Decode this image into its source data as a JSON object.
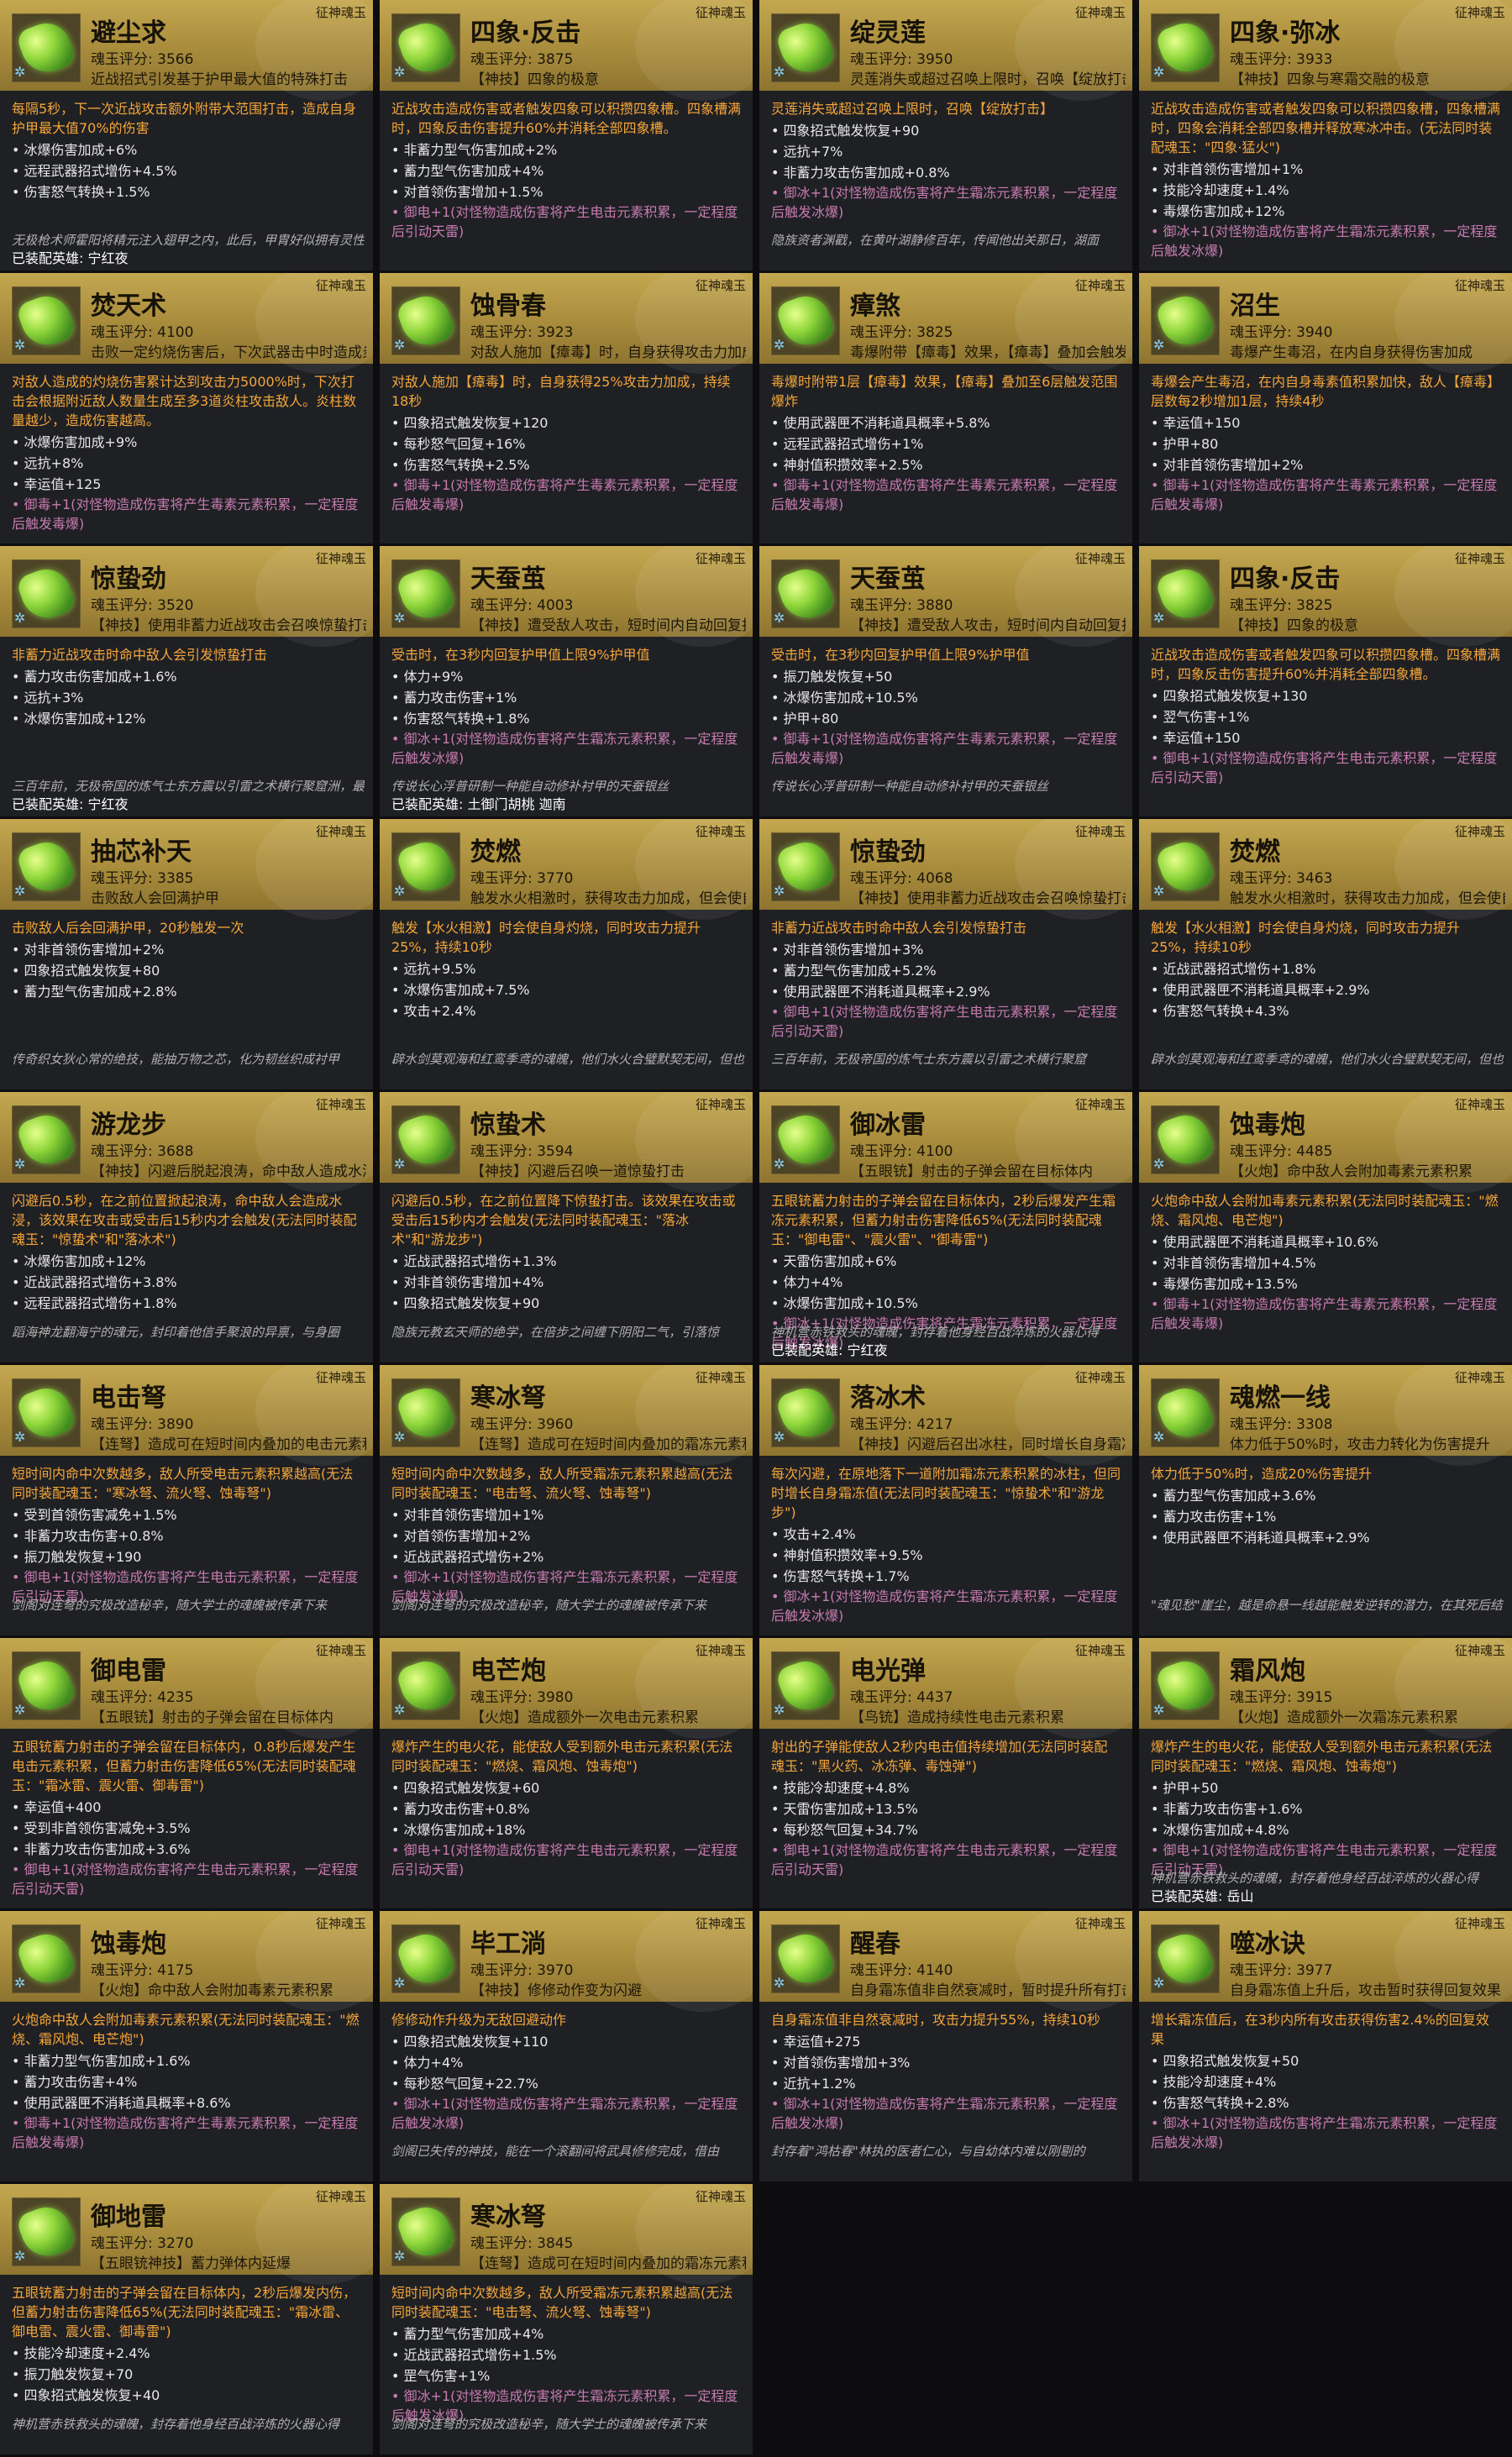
{
  "cards": [
    {
      "name": "避尘求",
      "tag": "征神魂玉",
      "score": "魂玉评分: 3566",
      "desc": "近战招式引发基于护甲最大值的特殊打击",
      "effect": "每隔5秒，下一次近战攻击额外附带大范围打击，造成自身护甲最大值70%的伤害",
      "stats": [
        "冰爆伤害加成+6%",
        "远程武器招式增伤+4.5%",
        "伤害怒气转换+1.5%"
      ],
      "eff2": "",
      "lore": "无极枪术师霍阳将精元注入翅甲之内，此后，甲胄好似拥有灵性般助他脱战躲胜",
      "equipped": "已装配英雄: 宁红夜"
    },
    {
      "name": "四象·反击",
      "tag": "征神魂玉",
      "score": "魂玉评分: 3875",
      "desc": "【神技】四象的极意",
      "effect": "近战攻击造成伤害或者触发四象可以积攒四象槽。四象槽满时，四象反击伤害提升60%并消耗全部四象槽。",
      "stats": [
        "非蓄力型气伤害加成+2%",
        "蓄力型气伤害加成+4%",
        "对首领伤害增加+1.5%"
      ],
      "eff2": "御电+1(对怪物造成伤害将产生电击元素积累，一定程度后引动天雷)",
      "lore": "",
      "equipped": ""
    },
    {
      "name": "绽灵莲",
      "tag": "征神魂玉",
      "score": "魂玉评分: 3950",
      "desc": "灵莲消失或超过召唤上限时，召唤【绽放打击】",
      "effect": "灵莲消失或超过召唤上限时，召唤【绽放打击】",
      "stats": [
        "四象招式触发恢复+90",
        "远抗+7%",
        "非蓄力攻击伤害加成+0.8%"
      ],
      "eff2": "御冰+1(对怪物造成伤害将产生霜冻元素积累，一定程度后触发冰爆)",
      "lore": "隐族资者渊戳，在黄叶湖静修百年，传闻他出关那日，湖面",
      "equipped": ""
    },
    {
      "name": "四象·弥冰",
      "tag": "征神魂玉",
      "score": "魂玉评分: 3933",
      "desc": "【神技】四象与寒霜交融的极意",
      "effect": "近战攻击造成伤害或者触发四象可以积攒四象槽，四象槽满时，四象会消耗全部四象槽并释放寒冰冲击。(无法同时装配魂玉：\"四象·猛火\")",
      "stats": [
        "对非首领伤害增加+1%",
        "技能冷却速度+1.4%",
        "毒爆伤害加成+12%"
      ],
      "eff2": "御冰+1(对怪物造成伤害将产生霜冻元素积累，一定程度后触发冰爆)",
      "lore": "",
      "equipped": ""
    },
    {
      "name": "焚天术",
      "tag": "征神魂玉",
      "score": "魂玉评分: 4100",
      "desc": "击败一定约烧伤害后，下次武器击中时造成炎柱",
      "effect": "对敌人造成的灼烧伤害累计达到攻击力5000%时，下次打击会根据附近敌人数量生成至多3道炎柱攻击敌人。炎柱数量越少，造成伤害越高。",
      "stats": [
        "冰爆伤害加成+9%",
        "远抗+8%",
        "幸运值+125"
      ],
      "eff2": "御毒+1(对怪物造成伤害将产生毒素元素积累，一定程度后触发毒爆)",
      "lore": "",
      "equipped": ""
    },
    {
      "name": "蚀骨春",
      "tag": "征神魂玉",
      "score": "魂玉评分: 3923",
      "desc": "对敌人施加【瘴毒】时，自身获得攻击力加成",
      "effect": "对敌人施加【瘴毒】时，自身获得25%攻击力加成，持续18秒",
      "stats": [
        "四象招式触发恢复+120",
        "每秒怒气回复+16%",
        "伤害怒气转换+2.5%"
      ],
      "eff2": "御毒+1(对怪物造成伤害将产生毒素元素积累，一定程度后触发毒爆)",
      "lore": "",
      "equipped": ""
    },
    {
      "name": "瘴煞",
      "tag": "征神魂玉",
      "score": "魂玉评分: 3825",
      "desc": "毒爆附带【瘴毒】效果，【瘴毒】叠加会触发范围打击",
      "effect": "毒爆时附带1层【瘴毒】效果，【瘴毒】叠加至6层触发范围爆炸",
      "stats": [
        "使用武器匣不消耗道具概率+5.8%",
        "远程武器招式增伤+1%",
        "神射值积攒效率+2.5%"
      ],
      "eff2": "御毒+1(对怪物造成伤害将产生毒素元素积累，一定程度后触发毒爆)",
      "lore": "",
      "equipped": ""
    },
    {
      "name": "沼生",
      "tag": "征神魂玉",
      "score": "魂玉评分: 3940",
      "desc": "毒爆产生毒沼，在内自身获得伤害加成",
      "effect": "毒爆会产生毒沼，在内自身毒素值积累加快，敌人【瘴毒】层数每2秒增加1层，持续4秒",
      "stats": [
        "幸运值+150",
        "护甲+80",
        "对非首领伤害增加+2%"
      ],
      "eff2": "御毒+1(对怪物造成伤害将产生毒素元素积累，一定程度后触发毒爆)",
      "lore": "",
      "equipped": ""
    },
    {
      "name": "惊蛰劲",
      "tag": "征神魂玉",
      "score": "魂玉评分: 3520",
      "desc": "【神技】使用非蓄力近战攻击会召唤惊蛰打击",
      "effect": "非蓄力近战攻击时命中敌人会引发惊蛰打击",
      "stats": [
        "蓄力攻击伤害加成+1.6%",
        "远抗+3%",
        "冰爆伤害加成+12%"
      ],
      "eff2": "",
      "lore": "三百年前，无极帝国的炼气士东方震以引雷之术横行聚窟洲，最后他散于苍穹之手",
      "equipped": "已装配英雄: 宁红夜"
    },
    {
      "name": "天蚕茧",
      "tag": "征神魂玉",
      "score": "魂玉评分: 4003",
      "desc": "【神技】遭受敌人攻击，短时间内自动回复护甲值",
      "effect": "受击时，在3秒内回复护甲值上限9%护甲值",
      "stats": [
        "体力+9%",
        "蓄力攻击伤害+1%",
        "伤害怒气转换+1.8%"
      ],
      "eff2": "御冰+1(对怪物造成伤害将产生霜冻元素积累，一定程度后触发冰爆)",
      "lore": "传说长心浮普研制一种能自动修补衬甲的天蚕银丝",
      "equipped": "已装配英雄: 土御门胡桃 迦南"
    },
    {
      "name": "天蚕茧",
      "tag": "征神魂玉",
      "score": "魂玉评分: 3880",
      "desc": "【神技】遭受敌人攻击，短时间内自动回复护甲值",
      "effect": "受击时，在3秒内回复护甲值上限9%护甲值",
      "stats": [
        "振刀触发恢复+50",
        "冰爆伤害加成+10.5%",
        "护甲+80"
      ],
      "eff2": "御毒+1(对怪物造成伤害将产生毒素元素积累，一定程度后触发毒爆)",
      "lore": "传说长心浮普研制一种能自动修补衬甲的天蚕银丝",
      "equipped": ""
    },
    {
      "name": "四象·反击",
      "tag": "征神魂玉",
      "score": "魂玉评分: 3825",
      "desc": "【神技】四象的极意",
      "effect": "近战攻击造成伤害或者触发四象可以积攒四象槽。四象槽满时，四象反击伤害提升60%并消耗全部四象槽。",
      "stats": [
        "四象招式触发恢复+130",
        "翌气伤害+1%",
        "幸运值+150"
      ],
      "eff2": "御电+1(对怪物造成伤害将产生电击元素积累，一定程度后引动天雷)",
      "lore": "",
      "equipped": ""
    },
    {
      "name": "抽芯补天",
      "tag": "征神魂玉",
      "score": "魂玉评分: 3385",
      "desc": "击败敌人会回满护甲",
      "effect": "击败敌人后会回满护甲，20秒触发一次",
      "stats": [
        "对非首领伤害增加+2%",
        "四象招式触发恢复+80",
        "蓄力型气伤害加成+2.8%"
      ],
      "eff2": "",
      "lore": "传奇织女狄心常的绝技，能抽万物之芯，化为韧丝织成衬甲",
      "equipped": ""
    },
    {
      "name": "焚燃",
      "tag": "征神魂玉",
      "score": "魂玉评分: 3770",
      "desc": "触发水火相激时，获得攻击力加成，但会使自身灼烧",
      "effect": "触发【水火相激】时会使自身灼烧，同时攻击力提升25%，持续10秒",
      "stats": [
        "远抗+9.5%",
        "冰爆伤害加成+7.5%",
        "攻击+2.4%"
      ],
      "eff2": "",
      "lore": "辟水剑莫观海和红鸾季鸢的魂魄，他们水火合璧默契无间，但也为彼此所伤",
      "equipped": ""
    },
    {
      "name": "惊蛰劲",
      "tag": "征神魂玉",
      "score": "魂玉评分: 4068",
      "desc": "【神技】使用非蓄力近战攻击会召唤惊蛰打击",
      "effect": "非蓄力近战攻击时命中敌人会引发惊蛰打击",
      "stats": [
        "对非首领伤害增加+3%",
        "蓄力型气伤害加成+5.2%",
        "使用武器匣不消耗道具概率+2.9%"
      ],
      "eff2": "御电+1(对怪物造成伤害将产生电击元素积累，一定程度后引动天雷)",
      "lore": "三百年前，无极帝国的炼气士东方震以引雷之术横行聚窟",
      "equipped": ""
    },
    {
      "name": "焚燃",
      "tag": "征神魂玉",
      "score": "魂玉评分: 3463",
      "desc": "触发水火相激时，获得攻击力加成，但会使自身灼烧",
      "effect": "触发【水火相激】时会使自身灼烧，同时攻击力提升25%，持续10秒",
      "stats": [
        "近战武器招式增伤+1.8%",
        "使用武器匣不消耗道具概率+2.9%",
        "伤害怒气转换+4.3%"
      ],
      "eff2": "",
      "lore": "辟水剑莫观海和红鸾季鸢的魂魄，他们水火合璧默契无间，但也为彼此所伤",
      "equipped": ""
    },
    {
      "name": "游龙步",
      "tag": "征神魂玉",
      "score": "魂玉评分: 3688",
      "desc": "【神技】闪避后脱起浪涛，命中敌人造成水浸",
      "effect": "闪避后0.5秒，在之前位置掀起浪涛，命中敌人会造成水浸，该效果在攻击或受击后15秒内才会触发(无法同时装配魂玉：\"惊蛰术\"和\"落冰术\")",
      "stats": [
        "冰爆伤害加成+12%",
        "近战武器招式增伤+3.8%",
        "远程武器招式增伤+1.8%"
      ],
      "eff2": "",
      "lore": "蹈海神龙翻海宁的魂元，封印着他信手聚浪的异禀，与身圈",
      "equipped": ""
    },
    {
      "name": "惊蛰术",
      "tag": "征神魂玉",
      "score": "魂玉评分: 3594",
      "desc": "【神技】闪避后召唤一道惊蛰打击",
      "effect": "闪避后0.5秒，在之前位置降下惊蛰打击。该效果在攻击或受击后15秒内才会触发(无法同时装配魂玉：\"落冰术\"和\"游龙步\")",
      "stats": [
        "近战武器招式增伤+1.3%",
        "对非首领伤害增加+4%",
        "四象招式触发恢复+90"
      ],
      "eff2": "",
      "lore": "隐族元教玄天师的绝学，在倍步之间缠下阴阳二气，引落惊",
      "equipped": ""
    },
    {
      "name": "御冰雷",
      "tag": "征神魂玉",
      "score": "魂玉评分: 4100",
      "desc": "【五眼铳】射击的子弹会留在目标体内",
      "effect": "五眼铳蓄力射击的子弹会留在目标体内，2秒后爆发产生霜冻元素积累，但蓄力射击伤害降低65%(无法同时装配魂玉：\"御电雷\"、\"震火雷\"、\"御毒雷\")",
      "stats": [
        "天雷伤害加成+6%",
        "体力+4%",
        "冰爆伤害加成+10.5%"
      ],
      "eff2": "御冰+1(对怪物造成伤害将产生霜冻元素积累，一定程度后触发冰爆)",
      "lore": "神机营赤铁救头的魂魄，封存着他身经百战淬炼的火器心得",
      "equipped": "已装配英雄: 宁红夜"
    },
    {
      "name": "蚀毒炮",
      "tag": "征神魂玉",
      "score": "魂玉评分: 4485",
      "desc": "【火炮】命中敌人会附加毒素元素积累",
      "effect": "火炮命中敌人会附加毒素元素积累(无法同时装配魂玉：\"燃烧、霜风炮、电芒炮\")",
      "stats": [
        "使用武器匣不消耗道具概率+10.6%",
        "对非首领伤害增加+4.5%",
        "毒爆伤害加成+13.5%"
      ],
      "eff2": "御毒+1(对怪物造成伤害将产生毒素元素积累，一定程度后触发毒爆)",
      "lore": "",
      "equipped": ""
    },
    {
      "name": "电击弩",
      "tag": "征神魂玉",
      "score": "魂玉评分: 3890",
      "desc": "【连弩】造成可在短时间内叠加的电击元素积累",
      "effect": "短时间内命中次数越多，敌人所受电击元素积累越高(无法同时装配魂玉：\"寒冰弩、流火弩、蚀毒弩\")",
      "stats": [
        "受到首领伤害减免+1.5%",
        "非蓄力攻击伤害+0.8%",
        "振刀触发恢复+190"
      ],
      "eff2": "御电+1(对怪物造成伤害将产生电击元素积累，一定程度后引动天雷)",
      "lore": "剑阁对连弩的究极改造秘辛，随大学士的魂魄被传承下来",
      "equipped": ""
    },
    {
      "name": "寒冰弩",
      "tag": "征神魂玉",
      "score": "魂玉评分: 3960",
      "desc": "【连弩】造成可在短时间内叠加的霜冻元素积累",
      "effect": "短时间内命中次数越多，敌人所受霜冻元素积累越高(无法同时装配魂玉：\"电击弩、流火弩、蚀毒弩\")",
      "stats": [
        "对非首领伤害增加+1%",
        "对首领伤害增加+2%",
        "近战武器招式增伤+2%"
      ],
      "eff2": "御冰+1(对怪物造成伤害将产生霜冻元素积累，一定程度后触发冰爆)",
      "lore": "剑阁对连弩的究极改造秘辛，随大学士的魂魄被传承下来",
      "equipped": ""
    },
    {
      "name": "落冰术",
      "tag": "征神魂玉",
      "score": "魂玉评分: 4217",
      "desc": "【神技】闪避后召出冰柱，同时增长自身霜冻值",
      "effect": "每次闪避，在原地落下一道附加霜冻元素积累的冰柱，但同时增长自身霜冻值(无法同时装配魂玉：\"惊蛰术\"和\"游龙步\")",
      "stats": [
        "攻击+2.4%",
        "神射值积攒效率+9.5%",
        "伤害怒气转换+1.7%"
      ],
      "eff2": "御冰+1(对怪物造成伤害将产生霜冻元素积累，一定程度后触发冰爆)",
      "lore": "",
      "equipped": ""
    },
    {
      "name": "魂燃一线",
      "tag": "征神魂玉",
      "score": "魂玉评分: 3308",
      "desc": "体力低于50%时，攻击力转化为伤害提升",
      "effect": "体力低于50%时，造成20%伤害提升",
      "stats": [
        "蓄力型气伤害加成+3.6%",
        "蓄力攻击伤害+1%",
        "使用武器匣不消耗道具概率+2.9%"
      ],
      "eff2": "",
      "lore": "\"魂见愁\"崖尘，越是命悬一线越能触发逆转的潜力，在其死后结晶于此",
      "equipped": ""
    },
    {
      "name": "御电雷",
      "tag": "征神魂玉",
      "score": "魂玉评分: 4235",
      "desc": "【五眼铳】射击的子弹会留在目标体内",
      "effect": "五眼铳蓄力射击的子弹会留在目标体内，0.8秒后爆发产生电击元素积累，但蓄力射击伤害降低65%(无法同时装配魂玉：\"霜冰雷、震火雷、御毒雷\")",
      "stats": [
        "幸运值+400",
        "受到非首领伤害减免+3.5%",
        "非蓄力攻击伤害加成+3.6%"
      ],
      "eff2": "御电+1(对怪物造成伤害将产生电击元素积累，一定程度后引动天雷)",
      "lore": "",
      "equipped": ""
    },
    {
      "name": "电芒炮",
      "tag": "征神魂玉",
      "score": "魂玉评分: 3980",
      "desc": "【火炮】造成额外一次电击元素积累",
      "effect": "爆炸产生的电火花，能使敌人受到额外电击元素积累(无法同时装配魂玉：\"燃烧、霜风炮、蚀毒炮\")",
      "stats": [
        "四象招式触发恢复+60",
        "蓄力攻击伤害+0.8%",
        "冰爆伤害加成+18%"
      ],
      "eff2": "御电+1(对怪物造成伤害将产生电击元素积累，一定程度后引动天雷)",
      "lore": "",
      "equipped": ""
    },
    {
      "name": "电光弹",
      "tag": "征神魂玉",
      "score": "魂玉评分: 4437",
      "desc": "【鸟铳】造成持续性电击元素积累",
      "effect": "射出的子弹能使敌人2秒内电击值持续增加(无法同时装配魂玉：\"黑火药、冰冻弹、毒蚀弹\")",
      "stats": [
        "技能冷却速度+4.8%",
        "天雷伤害加成+13.5%",
        "每秒怒气回复+34.7%"
      ],
      "eff2": "御电+1(对怪物造成伤害将产生电击元素积累，一定程度后引动天雷)",
      "lore": "",
      "equipped": ""
    },
    {
      "name": "霜风炮",
      "tag": "征神魂玉",
      "score": "魂玉评分: 3915",
      "desc": "【火炮】造成额外一次霜冻元素积累",
      "effect": "爆炸产生的电火花，能使敌人受到额外电击元素积累(无法同时装配魂玉：\"燃烧、霜风炮、蚀毒炮\")",
      "stats": [
        "护甲+50",
        "非蓄力攻击伤害+1.6%",
        "冰爆伤害加成+4.8%"
      ],
      "eff2": "御电+1(对怪物造成伤害将产生电击元素积累，一定程度后引动天雷)",
      "lore": "神机营赤铁救头的魂魄，封存着他身经百战淬炼的火器心得",
      "equipped": "已装配英雄: 岳山"
    },
    {
      "name": "蚀毒炮",
      "tag": "征神魂玉",
      "score": "魂玉评分: 4175",
      "desc": "【火炮】命中敌人会附加毒素元素积累",
      "effect": "火炮命中敌人会附加毒素元素积累(无法同时装配魂玉：\"燃烧、霜风炮、电芒炮\")",
      "stats": [
        "非蓄力型气伤害加成+1.6%",
        "蓄力攻击伤害+4%",
        "使用武器匣不消耗道具概率+8.6%"
      ],
      "eff2": "御毒+1(对怪物造成伤害将产生毒素元素积累，一定程度后触发毒爆)",
      "lore": "",
      "equipped": ""
    },
    {
      "name": "毕工淌",
      "tag": "征神魂玉",
      "score": "魂玉评分: 3970",
      "desc": "【神技】修修动作变为闪避",
      "effect": "修修动作升级为无敌回避动作",
      "stats": [
        "四象招式触发恢复+110",
        "体力+4%",
        "每秒怒气回复+22.7%"
      ],
      "eff2": "御冰+1(对怪物造成伤害将产生霜冻元素积累，一定程度后触发冰爆)",
      "lore": "剑阁已失传的神技，能在一个滚翻间将武具修修完成，借由",
      "equipped": ""
    },
    {
      "name": "醒春",
      "tag": "征神魂玉",
      "score": "魂玉评分: 4140",
      "desc": "自身霜冻值非自然衰减时，暂时提升所有打击伤害",
      "effect": "自身霜冻值非自然衰减时，攻击力提升55%，持续10秒",
      "stats": [
        "幸运值+275",
        "对首领伤害增加+3%",
        "近抗+1.2%"
      ],
      "eff2": "御冰+1(对怪物造成伤害将产生霜冻元素积累，一定程度后触发冰爆)",
      "lore": "封存着\"鸿枯春\"林执的医者仁心，与自幼体内难以刚剔的",
      "equipped": ""
    },
    {
      "name": "噬冰诀",
      "tag": "征神魂玉",
      "score": "魂玉评分: 3977",
      "desc": "自身霜冻值上升后，攻击暂时获得回复效果",
      "effect": "增长霜冻值后，在3秒内所有攻击获得伤害2.4%的回复效果",
      "stats": [
        "四象招式触发恢复+50",
        "技能冷却速度+4%",
        "伤害怒气转换+2.8%"
      ],
      "eff2": "御冰+1(对怪物造成伤害将产生霜冻元素积累，一定程度后触发冰爆)",
      "lore": "",
      "equipped": ""
    },
    {
      "name": "御地雷",
      "tag": "征神魂玉",
      "score": "魂玉评分: 3270",
      "desc": "【五眼铳神技】蓄力弹体内延爆",
      "effect": "五眼铳蓄力射击的子弹会留在目标体内，2秒后爆发内伤，但蓄力射击伤害降低65%(无法同时装配魂玉：\"霜冰雷、御电雷、震火雷、御毒雷\")",
      "stats": [
        "技能冷却速度+2.4%",
        "振刀触发恢复+70",
        "四象招式触发恢复+40"
      ],
      "eff2": "",
      "lore": "神机营赤铁救头的魂魄，封存着他身经百战淬炼的火器心得",
      "equipped": ""
    },
    {
      "name": "寒冰弩",
      "tag": "征神魂玉",
      "score": "魂玉评分: 3845",
      "desc": "【连弩】造成可在短时间内叠加的霜冻元素积累",
      "effect": "短时间内命中次数越多，敌人所受霜冻元素积累越高(无法同时装配魂玉：\"电击弩、流火弩、蚀毒弩\")",
      "stats": [
        "蓄力型气伤害加成+4%",
        "近战武器招式增伤+1.5%",
        "罡气伤害+1%"
      ],
      "eff2": "御冰+1(对怪物造成伤害将产生霜冻元素积累，一定程度后触发冰爆)",
      "lore": "剑阁对连弩的究极改造秘辛，随大学士的魂魄被传承下来",
      "equipped": ""
    }
  ]
}
